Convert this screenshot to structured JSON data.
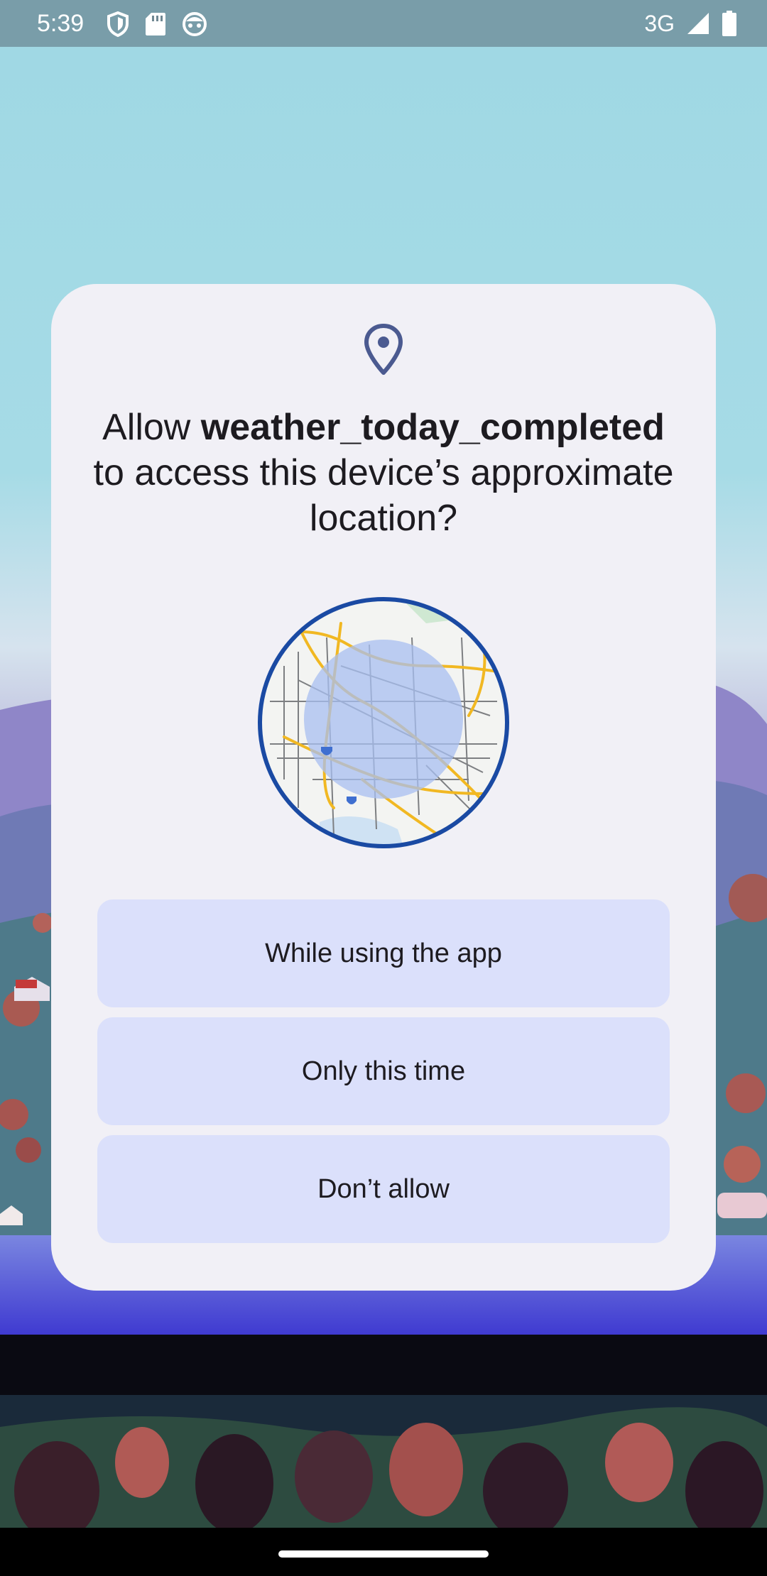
{
  "status_bar": {
    "time": "5:39",
    "network": "3G",
    "icons_left": [
      "shield-icon",
      "sd-card-icon",
      "android-face-icon"
    ],
    "icons_right": [
      "signal-icon",
      "battery-icon"
    ]
  },
  "dialog": {
    "icon": "location-pin-icon",
    "title_prefix": "Allow ",
    "app_name": "weather_today_completed",
    "title_suffix": "to access this device’s approximate location?",
    "map_image": "approximate-location-map",
    "buttons": {
      "while_using": "While using the app",
      "only_this_time": "Only this time",
      "dont_allow": "Don’t allow"
    }
  },
  "colors": {
    "dialog_bg": "#f1f0f6",
    "button_bg": "#dbe0fb",
    "accent_blue": "#1a4aa3",
    "text": "#1d1b20"
  }
}
